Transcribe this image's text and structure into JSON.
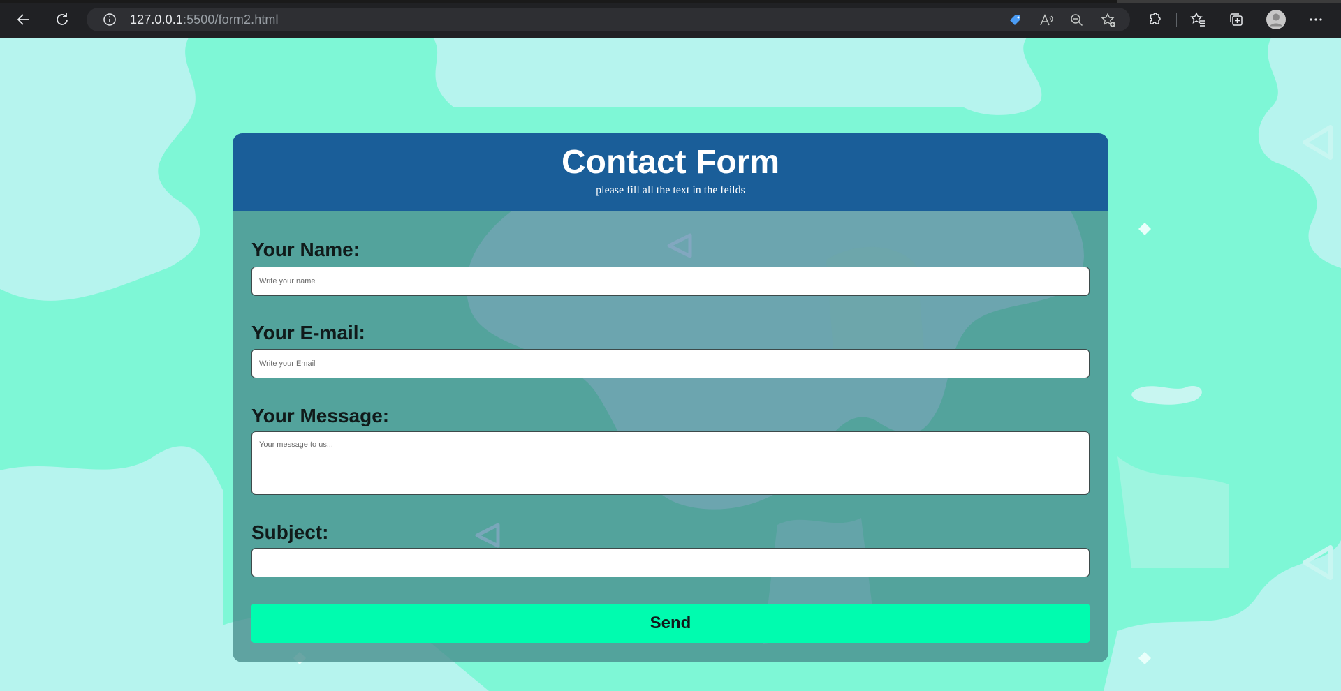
{
  "browser": {
    "url_host": "127.0.0.1",
    "url_path": ":5500/form2.html",
    "icons": [
      "back-icon",
      "reload-icon",
      "info-icon",
      "price-tag-icon",
      "read-aloud-icon",
      "zoom-out-icon",
      "add-favorite-icon",
      "extensions-icon",
      "favorites-icon",
      "collections-icon",
      "profile-icon",
      "more-icon"
    ]
  },
  "form": {
    "title": "Contact Form",
    "subtitle": "please fill all the text in the feilds",
    "name_label": "Your Name:",
    "name_placeholder": "Write your name",
    "email_label": "Your E-mail:",
    "email_placeholder": "Write your Email",
    "message_label": "Your Message:",
    "message_placeholder": "Your message to us...",
    "subject_label": "Subject:",
    "subject_value": "",
    "send_label": "Send"
  },
  "colors": {
    "page_bg": "#7ef7d6",
    "header_bg": "#1a5e99",
    "card_body_bg": "#468c8c",
    "send_bg": "#00fcaf"
  }
}
